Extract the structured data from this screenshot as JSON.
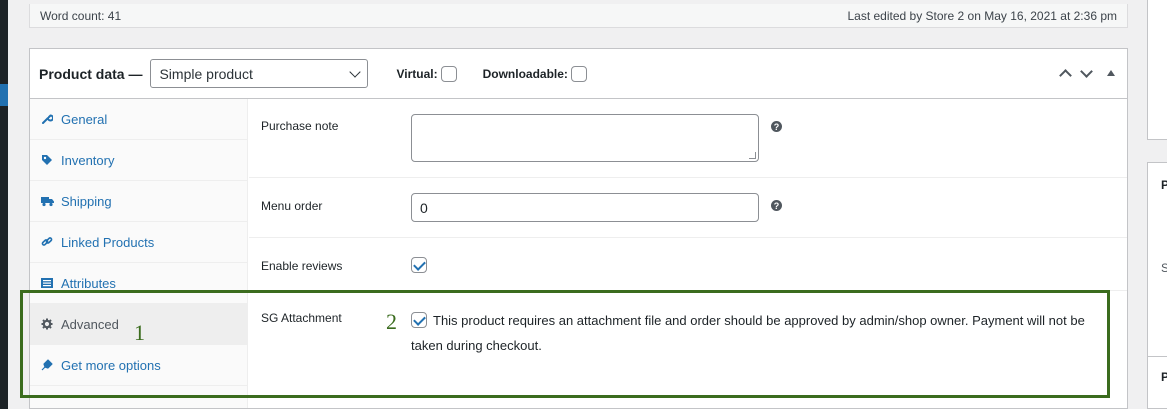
{
  "word_count": "Word count: 41",
  "last_edited": "Last edited by Store 2 on May 16, 2021 at 2:36 pm",
  "product_data": {
    "title": "Product data —",
    "product_type": "Simple product",
    "virtual_label": "Virtual:",
    "downloadable_label": "Downloadable:"
  },
  "tabs": [
    {
      "label": "General",
      "icon": "wrench-icon"
    },
    {
      "label": "Inventory",
      "icon": "tag-icon"
    },
    {
      "label": "Shipping",
      "icon": "truck-icon"
    },
    {
      "label": "Linked Products",
      "icon": "link-icon"
    },
    {
      "label": "Attributes",
      "icon": "list-icon"
    },
    {
      "label": "Advanced",
      "icon": "gear-icon"
    },
    {
      "label": "Get more options",
      "icon": "plugin-icon"
    }
  ],
  "fields": {
    "purchase_note": {
      "label": "Purchase note",
      "value": ""
    },
    "menu_order": {
      "label": "Menu order",
      "value": "0"
    },
    "enable_reviews": {
      "label": "Enable reviews",
      "checked": true
    },
    "sg_attachment": {
      "label": "SG Attachment",
      "checked": true,
      "description": "This product requires an attachment file and order should be approved by admin/shop owner. Payment will not be taken during checkout."
    }
  },
  "annotations": {
    "one": "1",
    "two": "2"
  },
  "right_fragments": {
    "a": "P",
    "b": "S",
    "c": "P"
  },
  "colors": {
    "link": "#2271b1",
    "annotation": "#3b6c1e"
  }
}
